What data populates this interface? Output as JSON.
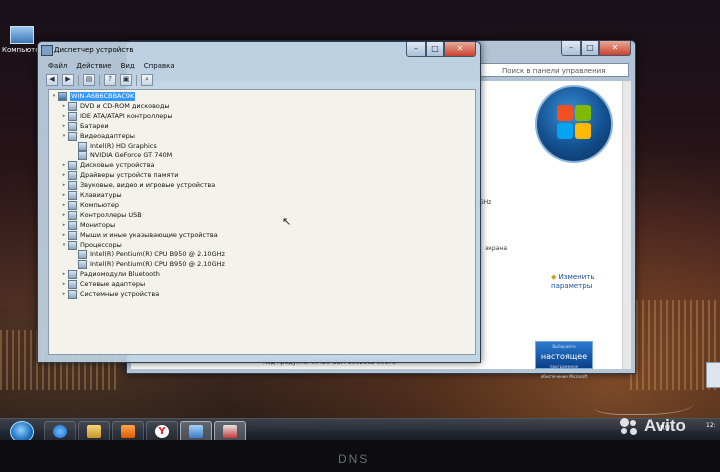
{
  "desktop": {
    "computer_icon_label": "Компьютер",
    "watermark": "Avito",
    "bezel_brand": "DNS"
  },
  "control_panel": {
    "search_placeholder": "Поиск в панели управления",
    "fragments": [
      "GHz",
      "экрана"
    ],
    "change_settings": "Изменить параметры",
    "genuine_top": "Выбирайте",
    "genuine_main": "настоящее",
    "genuine_sub": "программное обеспечение Microsoft",
    "product_key": "Код продукта: 00426-OEM-8992662-00173"
  },
  "device_manager": {
    "title": "Диспетчер устройств",
    "menu": [
      "Файл",
      "Действие",
      "Вид",
      "Справка"
    ],
    "toolbar_icons": [
      "back-arrow-icon",
      "forward-arrow-icon",
      "tree-view-icon",
      "properties-icon",
      "help-icon",
      "scan-hardware-icon"
    ],
    "tree": [
      {
        "label": "WIN-A6B6CBBAC9K",
        "level": 0,
        "expander": "▾",
        "root": true,
        "selected": true
      },
      {
        "label": "DVD и CD-ROM дисководы",
        "level": 1,
        "expander": "▸"
      },
      {
        "label": "IDE ATA/ATAPI контроллеры",
        "level": 1,
        "expander": "▸"
      },
      {
        "label": "Батареи",
        "level": 1,
        "expander": "▸"
      },
      {
        "label": "Видеоадаптеры",
        "level": 1,
        "expander": "▾"
      },
      {
        "label": "Intel(R) HD Graphics",
        "level": 2,
        "expander": ""
      },
      {
        "label": "NVIDIA GeForce GT 740M",
        "level": 2,
        "expander": ""
      },
      {
        "label": "Дисковые устройства",
        "level": 1,
        "expander": "▸"
      },
      {
        "label": "Драйверы устройств памяти",
        "level": 1,
        "expander": "▸"
      },
      {
        "label": "Звуковые, видео и игровые устройства",
        "level": 1,
        "expander": "▸"
      },
      {
        "label": "Клавиатуры",
        "level": 1,
        "expander": "▸"
      },
      {
        "label": "Компьютер",
        "level": 1,
        "expander": "▸"
      },
      {
        "label": "Контроллеры USB",
        "level": 1,
        "expander": "▸"
      },
      {
        "label": "Мониторы",
        "level": 1,
        "expander": "▸"
      },
      {
        "label": "Мыши и иные указывающие устройства",
        "level": 1,
        "expander": "▸"
      },
      {
        "label": "Процессоры",
        "level": 1,
        "expander": "▾"
      },
      {
        "label": "Intel(R) Pentium(R) CPU B950 @ 2.10GHz",
        "level": 2,
        "expander": ""
      },
      {
        "label": "Intel(R) Pentium(R) CPU B950 @ 2.10GHz",
        "level": 2,
        "expander": ""
      },
      {
        "label": "Радиомодули Bluetooth",
        "level": 1,
        "expander": "▸"
      },
      {
        "label": "Сетевые адаптеры",
        "level": 1,
        "expander": "▸"
      },
      {
        "label": "Системные устройства",
        "level": 1,
        "expander": "▸"
      }
    ]
  },
  "taskbar": {
    "items": [
      "start-orb",
      "ie-icon",
      "explorer-icon",
      "media-player-icon",
      "yandex-browser-icon",
      "control-panel-icon",
      "device-manager-icon"
    ],
    "lang": "RU",
    "time": "12:"
  }
}
